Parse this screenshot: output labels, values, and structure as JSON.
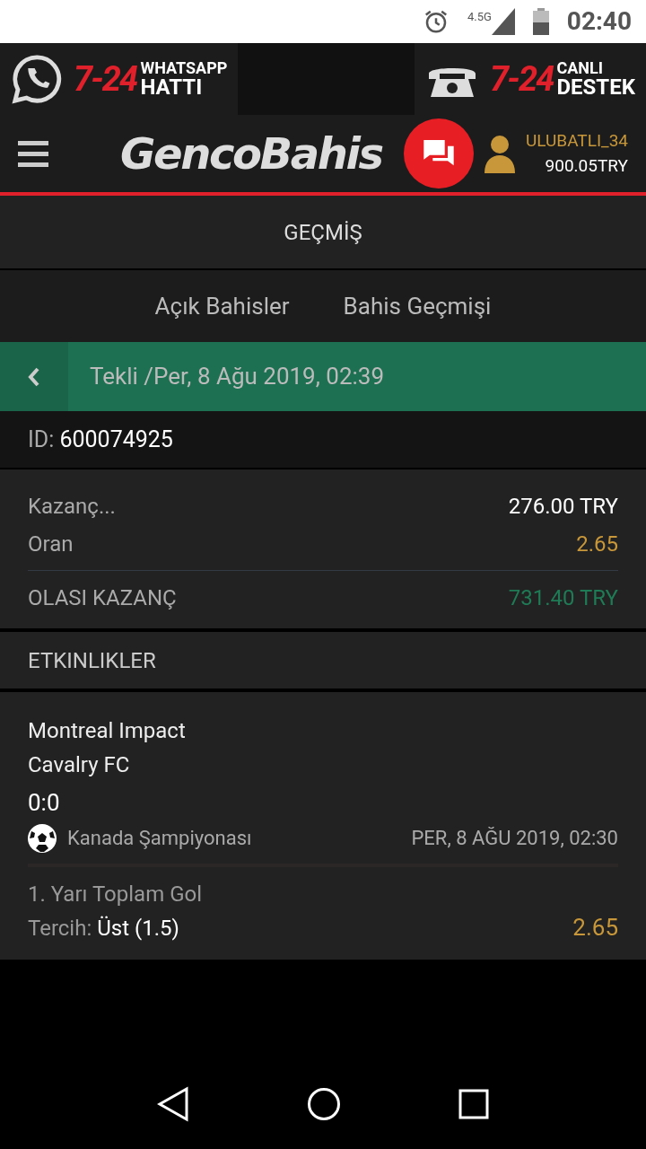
{
  "status_bar": {
    "network": "4.5G",
    "time": "02:40"
  },
  "banner": {
    "left": {
      "number": "7-24",
      "line1": "WHATSAPP",
      "line2": "HATTI"
    },
    "right": {
      "number": "7-24",
      "line1": "CANLI",
      "line2": "DESTEK"
    }
  },
  "header": {
    "logo": "GencoBahis",
    "username": "ULUBATLI_34",
    "balance": "900.05TRY"
  },
  "page_title": "GEÇMİŞ",
  "tabs": [
    {
      "label": "Açık Bahisler",
      "selected": false
    },
    {
      "label": "Bahis Geçmişi",
      "selected": false
    }
  ],
  "bet_bar": {
    "title": "Tekli /Per, 8 Ağu 2019, 02:39"
  },
  "bet_id": {
    "label": "ID:",
    "value": "600074925"
  },
  "summary": [
    {
      "label": "Kazanç...",
      "value": "276.00 TRY",
      "color": "#ffffff"
    },
    {
      "label": "Oran",
      "value": "2.65",
      "color": "#c8973a"
    }
  ],
  "total": {
    "label": "OLASI KAZANÇ",
    "value": "731.40 TRY"
  },
  "events_title": "ETKINLIKLER",
  "events": [
    {
      "home": "Montreal Impact",
      "away": "Cavalry FC",
      "score": "0:0",
      "league": "Kanada Şampiyonası",
      "date": "PER, 8 AĞU 2019, 02:30",
      "market": "1. Yarı Toplam Gol",
      "pick_label": "Tercih:",
      "pick": "Üst (1.5)",
      "odds": "2.65"
    }
  ]
}
